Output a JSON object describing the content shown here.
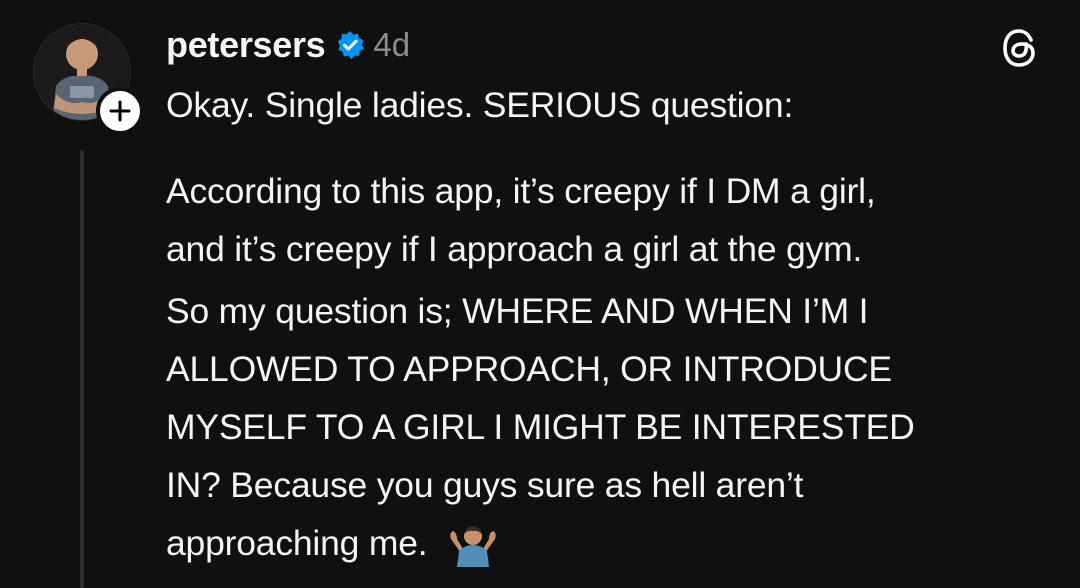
{
  "post": {
    "username": "petersers",
    "timestamp": "4d",
    "verified_color": "#0095f6",
    "verified_icon": "verified-badge-icon",
    "follow_icon": "plus-icon",
    "app_icon": "threads-logo-icon",
    "emoji_icon": "man-shrugging-emoji",
    "lines": [
      "Okay. Single ladies. SERIOUS question:",
      "According to this app, it’s creepy if I DM a girl,",
      "and it’s creepy if I approach a girl at the gym.",
      "So my question is; WHERE AND WHEN I’M I",
      "ALLOWED TO APPROACH, OR INTRODUCE",
      "MYSELF TO A GIRL I MIGHT BE INTERESTED",
      "IN? Because you guys sure as hell aren’t",
      "approaching me."
    ]
  }
}
